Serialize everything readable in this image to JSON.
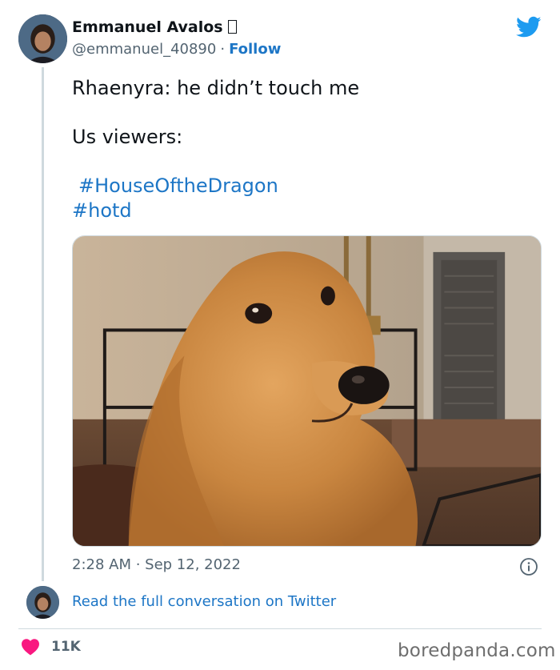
{
  "author": {
    "name": "Emmanuel Avalos",
    "handle": "@emmanuel_40890",
    "separator": "·",
    "follow_label": "Follow"
  },
  "tweet": {
    "line1": "Rhaenyra: he didn’t touch me",
    "line2": "Us viewers:",
    "hashtags": [
      "#HouseOftheDragon",
      "#hotd"
    ],
    "timestamp": "2:28 AM · Sep 12, 2022"
  },
  "footer": {
    "read_link": "Read the full conversation on Twitter",
    "like_count": "11K",
    "watermark": "boredpanda.com"
  },
  "icons": {
    "brand": "twitter-bird-icon",
    "info": "info-icon",
    "like": "heart-icon"
  },
  "colors": {
    "link_blue": "#1d76c6",
    "twitter_blue": "#1d9bf0",
    "heart_pink": "#f91880",
    "muted_text": "#536471"
  }
}
